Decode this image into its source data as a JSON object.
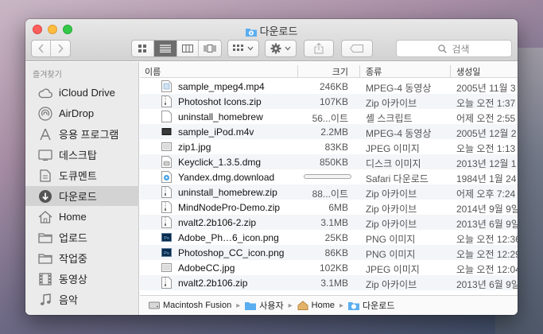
{
  "window": {
    "title": "다운로드"
  },
  "search": {
    "placeholder": "검색"
  },
  "sidebar": {
    "heading": "즐겨찾기",
    "items": [
      {
        "label": "iCloud Drive",
        "icon": "cloud-icon"
      },
      {
        "label": "AirDrop",
        "icon": "airdrop-icon"
      },
      {
        "label": "응용 프로그램",
        "icon": "applications-icon"
      },
      {
        "label": "데스크탑",
        "icon": "desktop-icon"
      },
      {
        "label": "도큐멘트",
        "icon": "documents-icon"
      },
      {
        "label": "다운로드",
        "icon": "downloads-icon",
        "selected": true
      },
      {
        "label": "Home",
        "icon": "home-icon"
      },
      {
        "label": "업로드",
        "icon": "folder-icon"
      },
      {
        "label": "작업중",
        "icon": "folder-icon"
      },
      {
        "label": "동영상",
        "icon": "movies-icon"
      },
      {
        "label": "음악",
        "icon": "music-icon"
      }
    ]
  },
  "columns": {
    "name": "이름",
    "size": "크기",
    "kind": "종류",
    "date": "생성일"
  },
  "files": [
    {
      "name": "sample_mpeg4.mp4",
      "size": "246KB",
      "kind": "MPEG-4 동영상",
      "date": "2005년 11월 3",
      "icon": "video-file-icon"
    },
    {
      "name": "Photoshot Icons.zip",
      "size": "107KB",
      "kind": "Zip 아카이브",
      "date": "오늘 오전 1:37",
      "icon": "zip-file-icon"
    },
    {
      "name": "uninstall_homebrew",
      "size": "56...이트",
      "kind": "셸 스크립트",
      "date": "어제 오전 2:55",
      "icon": "document-icon"
    },
    {
      "name": "sample_iPod.m4v",
      "size": "2.2MB",
      "kind": "MPEG-4 동영상",
      "date": "2005년 12월 2",
      "icon": "movie-thumb-icon"
    },
    {
      "name": "zip1.jpg",
      "size": "83KB",
      "kind": "JPEG 이미지",
      "date": "오늘 오전 1:13",
      "icon": "image-file-icon"
    },
    {
      "name": "Keyclick_1.3.5.dmg",
      "size": "850KB",
      "kind": "디스크 이미지",
      "date": "2013년 12월 1",
      "icon": "disk-image-icon"
    },
    {
      "name": "Yandex.dmg.download",
      "size": "",
      "progress": 0.0,
      "kind": "Safari 다운로드",
      "date": "1984년 1월 24",
      "icon": "safari-download-icon"
    },
    {
      "name": "uninstall_homebrew.zip",
      "size": "88...이트",
      "kind": "Zip 아카이브",
      "date": "어제 오후 7:24",
      "icon": "zip-file-icon"
    },
    {
      "name": "MindNodePro-Demo.zip",
      "size": "6MB",
      "kind": "Zip 아카이브",
      "date": "2014년 9월 9일",
      "icon": "zip-file-icon"
    },
    {
      "name": "nvalt2.2b106-2.zip",
      "size": "3.1MB",
      "kind": "Zip 아카이브",
      "date": "2013년 6월 9일",
      "icon": "zip-file-icon"
    },
    {
      "name": "Adobe_Ph…6_icon.png",
      "size": "25KB",
      "kind": "PNG 이미지",
      "date": "오늘 오전 12:36",
      "icon": "photoshop-png-icon"
    },
    {
      "name": "Photoshop_CC_icon.png",
      "size": "86KB",
      "kind": "PNG 이미지",
      "date": "오늘 오전 12:29",
      "icon": "photoshop-png-icon"
    },
    {
      "name": "AdobeCC.jpg",
      "size": "102KB",
      "kind": "JPEG 이미지",
      "date": "오늘 오전 12:04",
      "icon": "image-file-icon"
    },
    {
      "name": "nvalt2.2b106.zip",
      "size": "3.1MB",
      "kind": "Zip 아카이브",
      "date": "2013년 6월 9일",
      "icon": "zip-file-icon"
    }
  ],
  "pathbar": [
    "Macintosh Fusion",
    "사용자",
    "Home",
    "다운로드"
  ],
  "colors": {
    "selected_sidebar": "#d3d3d3",
    "folder_blue": "#5aaef0",
    "zebra": "#f3f5f8"
  }
}
